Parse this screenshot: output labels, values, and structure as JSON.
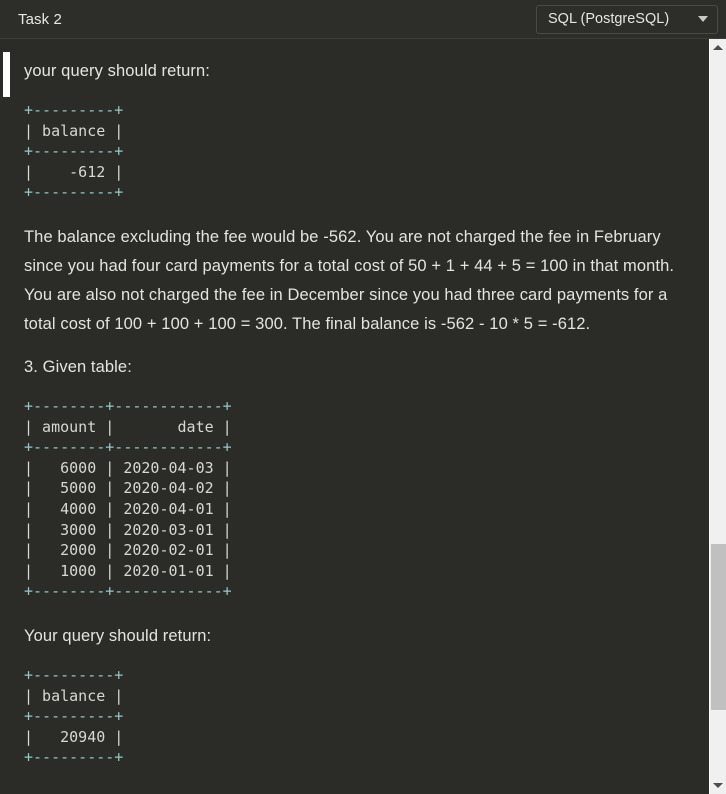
{
  "header": {
    "task_title": "Task 2",
    "language_select": {
      "selected": "SQL (PostgreSQL)",
      "caret_icon": "chevron-down-icon"
    }
  },
  "content": {
    "intro_line": "your query should return:",
    "result_table_1": {
      "border_top": "+---------+",
      "header_row": "| balance |",
      "border_mid": "+---------+",
      "value_row": "|    -612 |",
      "border_bottom": "+---------+",
      "columns": [
        "balance"
      ],
      "rows": [
        [
          "-612"
        ]
      ]
    },
    "explanation": "The balance excluding the fee would be -562. You are not charged the fee in February since you had four card payments for a total cost of 50 + 1 + 44 + 5 = 100 in that month. You are also not charged the fee in December since you had three card payments for a total cost of 100 + 100 + 100 = 300. The final balance is -562 - 10 * 5 = -612.",
    "section_heading": "3. Given table:",
    "given_table": {
      "border_top": "+--------+------------+",
      "header_row": "| amount |       date |",
      "border_mid": "+--------+------------+",
      "border_bottom": "+--------+------------+",
      "columns": [
        "amount",
        "date"
      ],
      "rows": [
        [
          "6000",
          "2020-04-03"
        ],
        [
          "5000",
          "2020-04-02"
        ],
        [
          "4000",
          "2020-04-01"
        ],
        [
          "3000",
          "2020-03-01"
        ],
        [
          "2000",
          "2020-02-01"
        ],
        [
          "1000",
          "2020-01-01"
        ]
      ],
      "row_lines": [
        "|   6000 | 2020-04-03 |",
        "|   5000 | 2020-04-02 |",
        "|   4000 | 2020-04-01 |",
        "|   3000 | 2020-03-01 |",
        "|   2000 | 2020-02-01 |",
        "|   1000 | 2020-01-01 |"
      ]
    },
    "outro_line": "Your query should return:",
    "result_table_2": {
      "border_top": "+---------+",
      "header_row": "| balance |",
      "border_mid": "+---------+",
      "value_row": "|   20940 |",
      "border_bottom": "+---------+",
      "columns": [
        "balance"
      ],
      "rows": [
        [
          "20940"
        ]
      ]
    }
  },
  "scrollbar": {
    "up_arrow_icon": "triangle-up-icon",
    "down_arrow_icon": "triangle-down-icon"
  },
  "colors": {
    "background": "#2b2b28",
    "header_background": "#2d2d2a",
    "text": "#e4e4df",
    "ascii_rule": "#93c9c4",
    "ascii_bar": "#9a9a53",
    "scrollbar_track": "#f0f0f0",
    "scrollbar_thumb": "#c0c0c0"
  }
}
